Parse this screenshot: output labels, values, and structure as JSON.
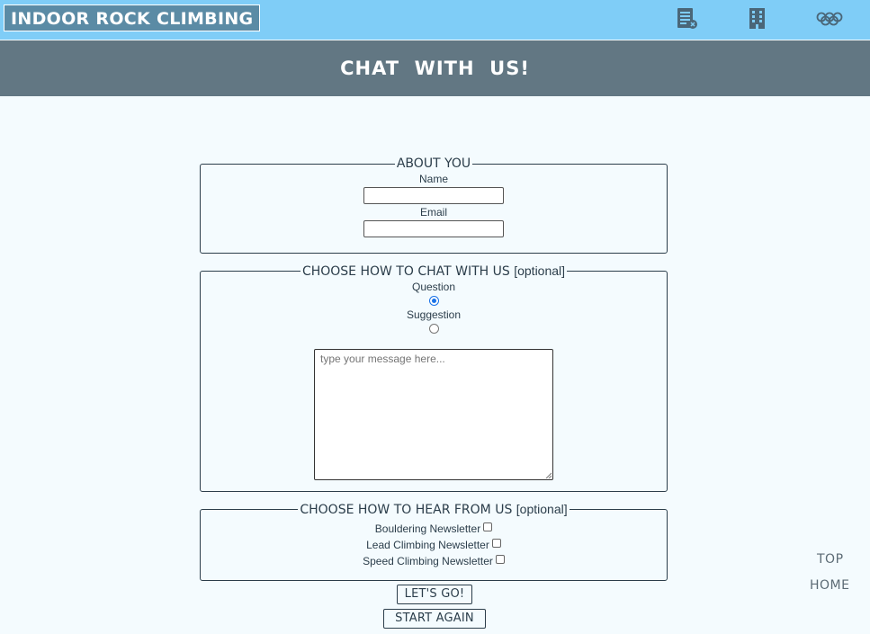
{
  "header": {
    "brand": "INDOOR ROCK CLIMBING",
    "nav_icons": [
      "timetable-icon",
      "building-icon",
      "olympic-rings-icon"
    ],
    "bg_color": "#7fcdf7"
  },
  "banner": {
    "title": "CHAT  WITH  US!",
    "bg_color": "#627783"
  },
  "about": {
    "legend": "ABOUT YOU",
    "name_label": "Name",
    "name_value": "",
    "email_label": "Email",
    "email_value": ""
  },
  "chat": {
    "legend": "CHOOSE HOW TO CHAT WITH US",
    "legend_note": "[optional]",
    "options": [
      {
        "label": "Question",
        "selected": true
      },
      {
        "label": "Suggestion",
        "selected": false
      }
    ],
    "message_placeholder": "type your message here..."
  },
  "hear": {
    "legend": "CHOOSE HOW TO HEAR FROM US",
    "legend_note": "[optional]",
    "options": [
      {
        "label": "Bouldering Newsletter",
        "checked": false
      },
      {
        "label": "Lead Climbing Newsletter",
        "checked": false
      },
      {
        "label": "Speed Climbing Newsletter",
        "checked": false
      }
    ]
  },
  "buttons": {
    "submit": "LET'S GO!",
    "reset": "START AGAIN"
  },
  "side_links": {
    "top": "TOP",
    "home": "HOME"
  }
}
